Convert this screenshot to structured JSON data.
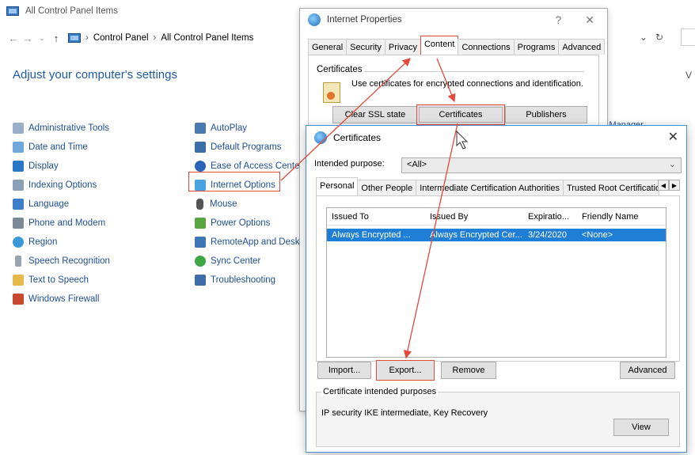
{
  "control_panel": {
    "window_title": "All Control Panel Items",
    "breadcrumb": [
      "Control Panel",
      "All Control Panel Items"
    ],
    "heading": "Adjust your computer's settings",
    "view_label": "V",
    "column1": [
      {
        "label": "Administrative Tools",
        "icon": "tools-icon"
      },
      {
        "label": "Date and Time",
        "icon": "clock-icon"
      },
      {
        "label": "Display",
        "icon": "monitor-icon"
      },
      {
        "label": "Indexing Options",
        "icon": "indexing-icon"
      },
      {
        "label": "Language",
        "icon": "language-icon"
      },
      {
        "label": "Phone and Modem",
        "icon": "phone-icon"
      },
      {
        "label": "Region",
        "icon": "globe-icon"
      },
      {
        "label": "Speech Recognition",
        "icon": "microphone-icon"
      },
      {
        "label": "Text to Speech",
        "icon": "speech-icon"
      },
      {
        "label": "Windows Firewall",
        "icon": "firewall-icon"
      }
    ],
    "column2": [
      {
        "label": "AutoPlay",
        "icon": "autoplay-icon"
      },
      {
        "label": "Default Programs",
        "icon": "default-programs-icon"
      },
      {
        "label": "Ease of Access Center",
        "icon": "ease-of-access-icon"
      },
      {
        "label": "Internet Options",
        "icon": "internet-options-icon"
      },
      {
        "label": "Mouse",
        "icon": "mouse-icon"
      },
      {
        "label": "Power Options",
        "icon": "power-icon"
      },
      {
        "label": "RemoteApp and Deskt",
        "icon": "remoteapp-icon"
      },
      {
        "label": "Sync Center",
        "icon": "sync-icon"
      },
      {
        "label": "Troubleshooting",
        "icon": "troubleshooting-icon"
      }
    ],
    "partial_right_label": "l Manager"
  },
  "internet_properties": {
    "title": "Internet Properties",
    "help": "?",
    "close": "✕",
    "tabs": [
      "General",
      "Security",
      "Privacy",
      "Content",
      "Connections",
      "Programs",
      "Advanced"
    ],
    "active_tab": "Content",
    "certificates_group": "Certificates",
    "certificates_desc": "Use certificates for encrypted connections and identification.",
    "buttons": {
      "clear_ssl": "Clear SSL state",
      "certificates": "Certificates",
      "publishers": "Publishers"
    }
  },
  "certificates_dialog": {
    "title": "Certificates",
    "close": "✕",
    "intended_purpose_label": "Intended purpose:",
    "intended_purpose_value": "<All>",
    "tabs": [
      "Personal",
      "Other People",
      "Intermediate Certification Authorities",
      "Trusted Root Certification"
    ],
    "columns": [
      "Issued To",
      "Issued By",
      "Expiratio...",
      "Friendly Name"
    ],
    "rows": [
      {
        "issued_to": "Always Encrypted ...",
        "issued_by": "Always Encrypted Cer...",
        "expiration": "3/24/2020",
        "friendly_name": "<None>"
      }
    ],
    "buttons": {
      "import": "Import...",
      "export": "Export...",
      "remove": "Remove",
      "advanced": "Advanced",
      "view": "View"
    },
    "intended_purposes_label": "Certificate intended purposes",
    "intended_purposes_value": "IP security IKE intermediate, Key Recovery"
  },
  "colors": {
    "annotation": "#e34a3a",
    "selection": "#1f7ed6",
    "link": "#1e4f92"
  }
}
